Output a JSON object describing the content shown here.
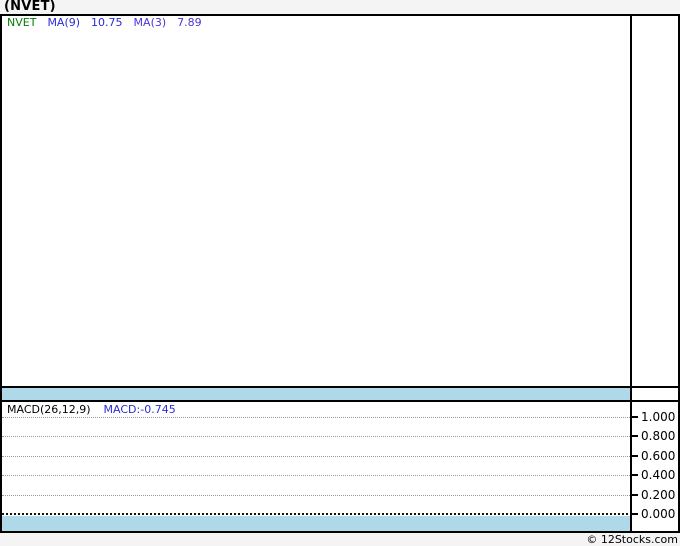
{
  "page": {
    "title": "(NVET)",
    "copyright": "© 12Stocks.com",
    "background": "#f4f4f4"
  },
  "price_panel": {
    "legend": {
      "symbol": "NVET",
      "ma9_label": "MA(9)",
      "ma9_value": "10.75",
      "ma3_label": "MA(3)",
      "ma3_value": "7.89"
    },
    "colors": {
      "symbol": "#067d06",
      "ma9": "#2b2bd4",
      "ma3": "#4a34d4"
    }
  },
  "macd_panel": {
    "legend_label": "MACD(26,12,9)",
    "legend_value": "MACD:-0.745",
    "yticks": [
      "1.000",
      "0.800",
      "0.600",
      "0.400",
      "0.200",
      "0.000"
    ]
  },
  "colors": {
    "band": "#aed9e8",
    "frame": "#000000",
    "gridline": "#999999",
    "plot_background": "#ffffff"
  },
  "chart_data": {
    "type": "line",
    "title": "(NVET)",
    "legend_position": "top-left",
    "panels": [
      {
        "name": "price",
        "series": [
          {
            "name": "NVET",
            "color": "#067d06",
            "values": []
          },
          {
            "name": "MA(9)",
            "color": "#2b2bd4",
            "last_value": 10.75,
            "values": []
          },
          {
            "name": "MA(3)",
            "color": "#4a34d4",
            "last_value": 7.89,
            "values": []
          }
        ],
        "note": "price plot area is empty (no candles/lines rendered) in the screenshot"
      },
      {
        "name": "MACD(26,12,9)",
        "last_value": -0.745,
        "ylim": [
          0.0,
          1.0
        ],
        "yticks": [
          1.0,
          0.8,
          0.6,
          0.4,
          0.2,
          0.0
        ],
        "grid": "dotted horizontal lines at each tick, dense dotted line at 0.000",
        "values": []
      }
    ],
    "source": "© 12Stocks.com"
  }
}
